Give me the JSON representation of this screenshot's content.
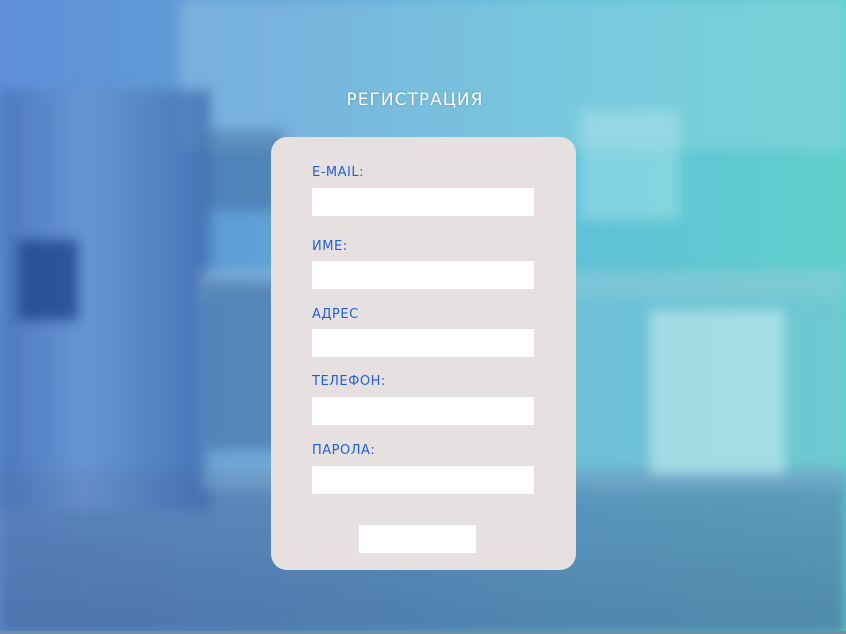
{
  "page": {
    "title": "РЕГИСТРАЦИЯ"
  },
  "form": {
    "fields": [
      {
        "label": "E-MAIL:",
        "value": "",
        "placeholder": ""
      },
      {
        "label": "ИМЕ:",
        "value": "",
        "placeholder": ""
      },
      {
        "label": "АДРЕС",
        "value": "",
        "placeholder": ""
      },
      {
        "label": "ТЕЛЕФОН:",
        "value": "",
        "placeholder": ""
      },
      {
        "label": "ПАРОЛА:",
        "value": "",
        "placeholder": ""
      }
    ],
    "submit_label": ""
  },
  "colors": {
    "label_blue": "#1f5fd8",
    "card_background": "#e6e1e0",
    "title_white": "#ffffff"
  }
}
